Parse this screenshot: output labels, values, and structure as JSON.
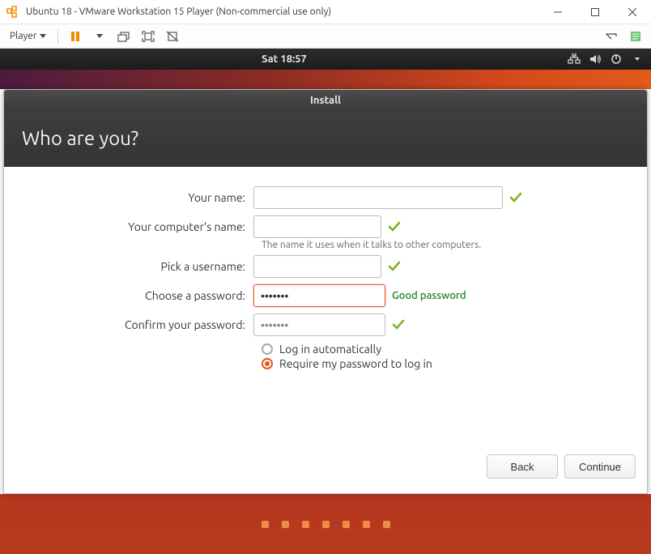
{
  "window": {
    "title": "Ubuntu 18 - VMware Workstation 15 Player (Non-commercial use only)"
  },
  "vmware_toolbar": {
    "player_label": "Player"
  },
  "ubuntu_topbar": {
    "clock": "Sat 18:57"
  },
  "installer": {
    "title": "Install",
    "heading": "Who are you?",
    "labels": {
      "name": "Your name:",
      "computer": "Your computer's name:",
      "username": "Pick a username:",
      "password": "Choose a password:",
      "confirm": "Confirm your password:"
    },
    "values": {
      "name": "",
      "computer": "",
      "username": "",
      "password": "•••••••",
      "confirm": "•••••••"
    },
    "password_quality": "Good password",
    "computer_helper": "The name it uses when it talks to other computers.",
    "login_options": {
      "auto": "Log in automatically",
      "require": "Require my password to log in",
      "selected": "require"
    },
    "buttons": {
      "back": "Back",
      "continue": "Continue"
    }
  }
}
